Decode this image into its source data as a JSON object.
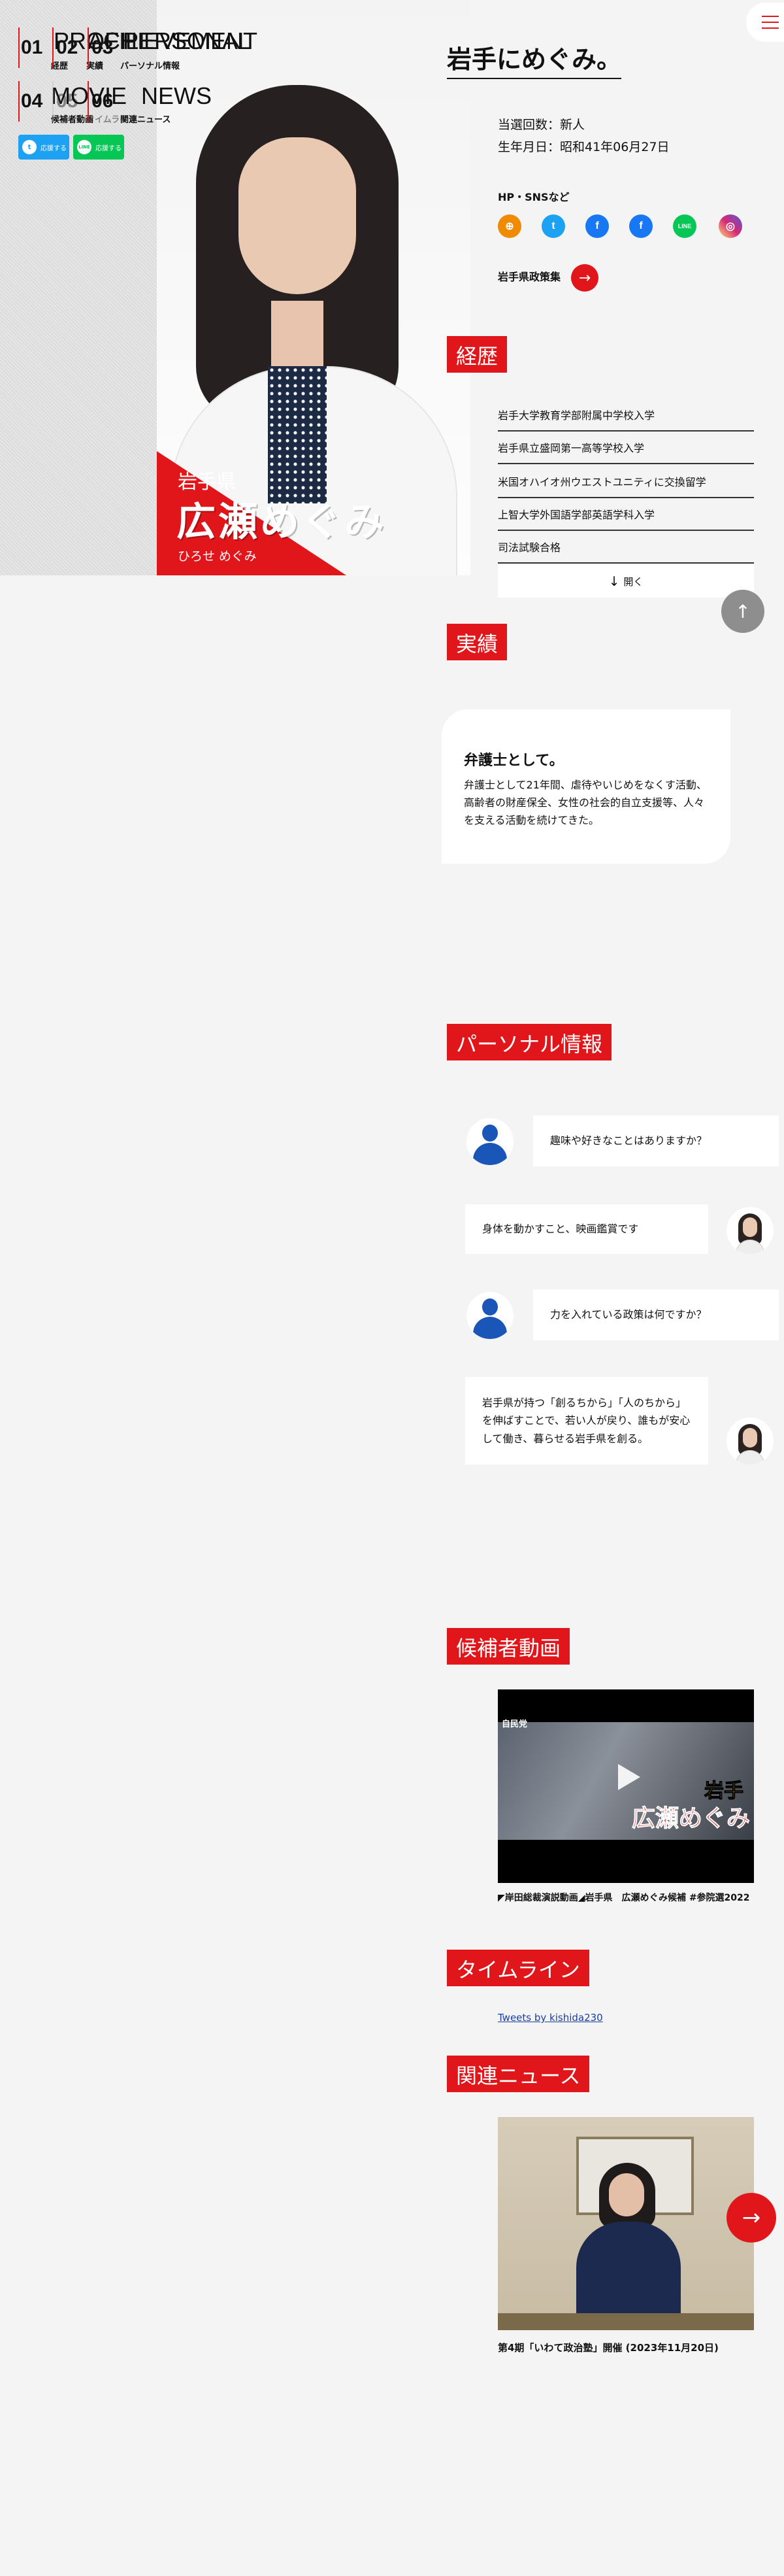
{
  "hero": {
    "prefecture": "岩手県",
    "name": "広瀬めぐみ",
    "kana": "ひろせ めぐみ"
  },
  "nav": {
    "items": [
      {
        "num": "01",
        "en": "PROFILE",
        "jp": "経歴"
      },
      {
        "num": "02",
        "en": "ACHIEVEMENT",
        "jp": "実績"
      },
      {
        "num": "03",
        "en": "PERSONAL",
        "jp": "パーソナル情報"
      },
      {
        "num": "04",
        "en": "MOVIE",
        "jp": "候補者動画"
      },
      {
        "num": "05",
        "en": "TIMELINE",
        "jp": "タイムライン"
      },
      {
        "num": "06",
        "en": "NEWS",
        "jp": "関連ニュース"
      }
    ],
    "share": [
      {
        "label": "応援する",
        "icon": "twitter-icon",
        "color": "#1da1f2"
      },
      {
        "label": "応援する",
        "icon": "line-icon",
        "color": "#06c755"
      }
    ]
  },
  "main": {
    "title": "岩手にめぐみ。",
    "elections": "当選回数：新人",
    "birthday": "生年月日：昭和41年06月27日",
    "sns_heading": "HP・SNSなど",
    "sns": [
      {
        "icon": "globe-icon",
        "color": "#f08a00"
      },
      {
        "icon": "twitter-icon",
        "color": "#1da1f2"
      },
      {
        "icon": "facebook-icon",
        "color": "#1877f2"
      },
      {
        "icon": "facebook-icon",
        "color": "#1877f2"
      },
      {
        "icon": "line-icon",
        "color": "#06c755"
      },
      {
        "icon": "instagram-icon",
        "color": "#d62976"
      }
    ],
    "policy_link": "岩手県政策集"
  },
  "career": {
    "heading": "経歴",
    "items": [
      "岩手大学教育学部附属中学校入学",
      "岩手県立盛岡第一高等学校入学",
      "米国オハイオ州ウエストユニティに交換留学",
      "上智大学外国語学部英語学科入学",
      "司法試験合格"
    ],
    "open_label": "開く"
  },
  "achievement": {
    "heading": "実績",
    "title": "弁護士として。",
    "text": "弁護士として21年間、虐待やいじめをなくす活動、高齢者の財産保全、女性の社会的自立支援等、人々を支える活動を続けてきた。"
  },
  "personal": {
    "heading": "パーソナル情報",
    "qa": [
      {
        "q": "趣味や好きなことはありますか？",
        "a": "身体を動かすこと、映画鑑賞です"
      },
      {
        "q": "力を入れている政策は何ですか？",
        "a": "岩手県が持つ「創るちから」「人のちから」を伸ばすことで、若い人が戻り、誰もが安心して働き、暮らせる岩手県を創る。"
      }
    ]
  },
  "movie": {
    "heading": "候補者動画",
    "tag": "自民党",
    "overlay_pref": "岩手",
    "overlay_name": "広瀬めぐみ",
    "caption": "◤岸田総裁演説動画◢岩手県　広瀬めぐみ候補 #参院選2022"
  },
  "timeline": {
    "heading": "タイムライン",
    "link": "Tweets by kishida230"
  },
  "news": {
    "heading": "関連ニュース",
    "caption": "第4期「いわて政治塾」開催 (2023年11月20日)"
  },
  "colors": {
    "accent": "#e0161b",
    "background": "#f4f4f4"
  }
}
